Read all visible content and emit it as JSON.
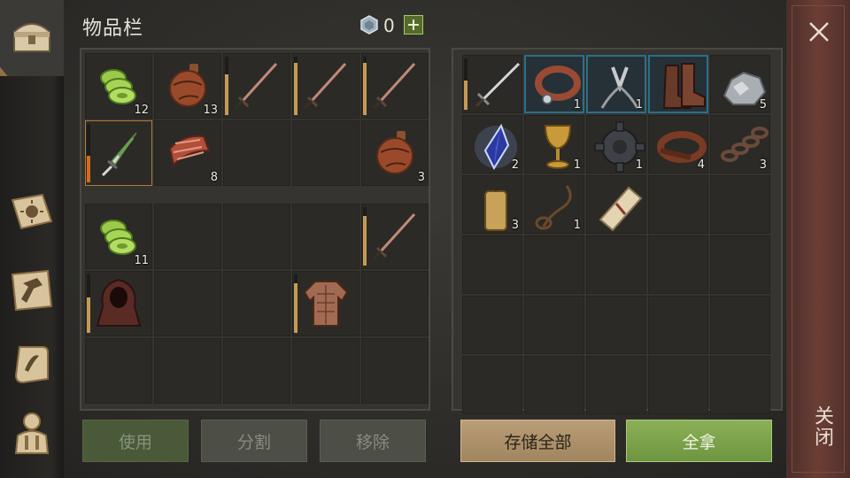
{
  "title": "物品栏",
  "currency": {
    "icon": "gem-coin-icon",
    "count": "0"
  },
  "close_label": "关闭",
  "buttons": {
    "use": "使用",
    "split": "分割",
    "remove": "移除",
    "store_all": "存储全部",
    "take_all": "全拿"
  },
  "left_top": [
    {
      "icon": "cabbage-icon",
      "qty": "12"
    },
    {
      "icon": "flask-icon",
      "qty": "13"
    },
    {
      "icon": "sword-icon",
      "qty": "",
      "durability": 0.7
    },
    {
      "icon": "sword-icon",
      "qty": "",
      "durability": 0.9
    },
    {
      "icon": "sword-icon",
      "qty": "",
      "durability": 0.9
    },
    {
      "icon": "dagger-icon",
      "qty": "",
      "durability": 0.45,
      "selected": true
    },
    {
      "icon": "meat-icon",
      "qty": "8"
    },
    {
      "icon": "",
      "qty": ""
    },
    {
      "icon": "",
      "qty": ""
    },
    {
      "icon": "flask-icon",
      "qty": "3"
    }
  ],
  "left_bottom": [
    {
      "icon": "cabbage-icon",
      "qty": "11"
    },
    {
      "icon": "",
      "qty": ""
    },
    {
      "icon": "",
      "qty": ""
    },
    {
      "icon": "",
      "qty": ""
    },
    {
      "icon": "sword-icon",
      "qty": "",
      "durability": 0.85
    },
    {
      "icon": "hood-icon",
      "qty": "",
      "durability": 0.6
    },
    {
      "icon": "",
      "qty": ""
    },
    {
      "icon": "",
      "qty": ""
    },
    {
      "icon": "armor-icon",
      "qty": "",
      "durability": 0.85
    },
    {
      "icon": "",
      "qty": ""
    },
    {
      "icon": "",
      "qty": ""
    },
    {
      "icon": "",
      "qty": ""
    },
    {
      "icon": "",
      "qty": ""
    },
    {
      "icon": "",
      "qty": ""
    },
    {
      "icon": "",
      "qty": ""
    }
  ],
  "right_grid": [
    {
      "icon": "longsword-icon",
      "qty": "",
      "durability": 0.5
    },
    {
      "icon": "collar-icon",
      "qty": "1",
      "highlight": true
    },
    {
      "icon": "pliers-icon",
      "qty": "1",
      "highlight": true
    },
    {
      "icon": "boots-icon",
      "qty": "",
      "highlight": true
    },
    {
      "icon": "ore-icon",
      "qty": "5"
    },
    {
      "icon": "crystal-icon",
      "qty": "2"
    },
    {
      "icon": "goblet-icon",
      "qty": "1"
    },
    {
      "icon": "gear-part-icon",
      "qty": "1"
    },
    {
      "icon": "leather-icon",
      "qty": "4"
    },
    {
      "icon": "chain-icon",
      "qty": "3"
    },
    {
      "icon": "candle-icon",
      "qty": "3"
    },
    {
      "icon": "rope-icon",
      "qty": "1"
    },
    {
      "icon": "scroll-icon",
      "qty": ""
    },
    {
      "icon": "",
      "qty": ""
    },
    {
      "icon": "",
      "qty": ""
    },
    {
      "icon": "",
      "qty": ""
    },
    {
      "icon": "",
      "qty": ""
    },
    {
      "icon": "",
      "qty": ""
    },
    {
      "icon": "",
      "qty": ""
    },
    {
      "icon": "",
      "qty": ""
    },
    {
      "icon": "",
      "qty": ""
    },
    {
      "icon": "",
      "qty": ""
    },
    {
      "icon": "",
      "qty": ""
    },
    {
      "icon": "",
      "qty": ""
    },
    {
      "icon": "",
      "qty": ""
    },
    {
      "icon": "",
      "qty": ""
    },
    {
      "icon": "",
      "qty": ""
    },
    {
      "icon": "",
      "qty": ""
    },
    {
      "icon": "",
      "qty": ""
    },
    {
      "icon": "",
      "qty": ""
    }
  ],
  "rail_icons": [
    "chest-icon",
    "sun-book-icon",
    "craft-hammer-icon",
    "quest-scroll-icon",
    "character-icon"
  ]
}
